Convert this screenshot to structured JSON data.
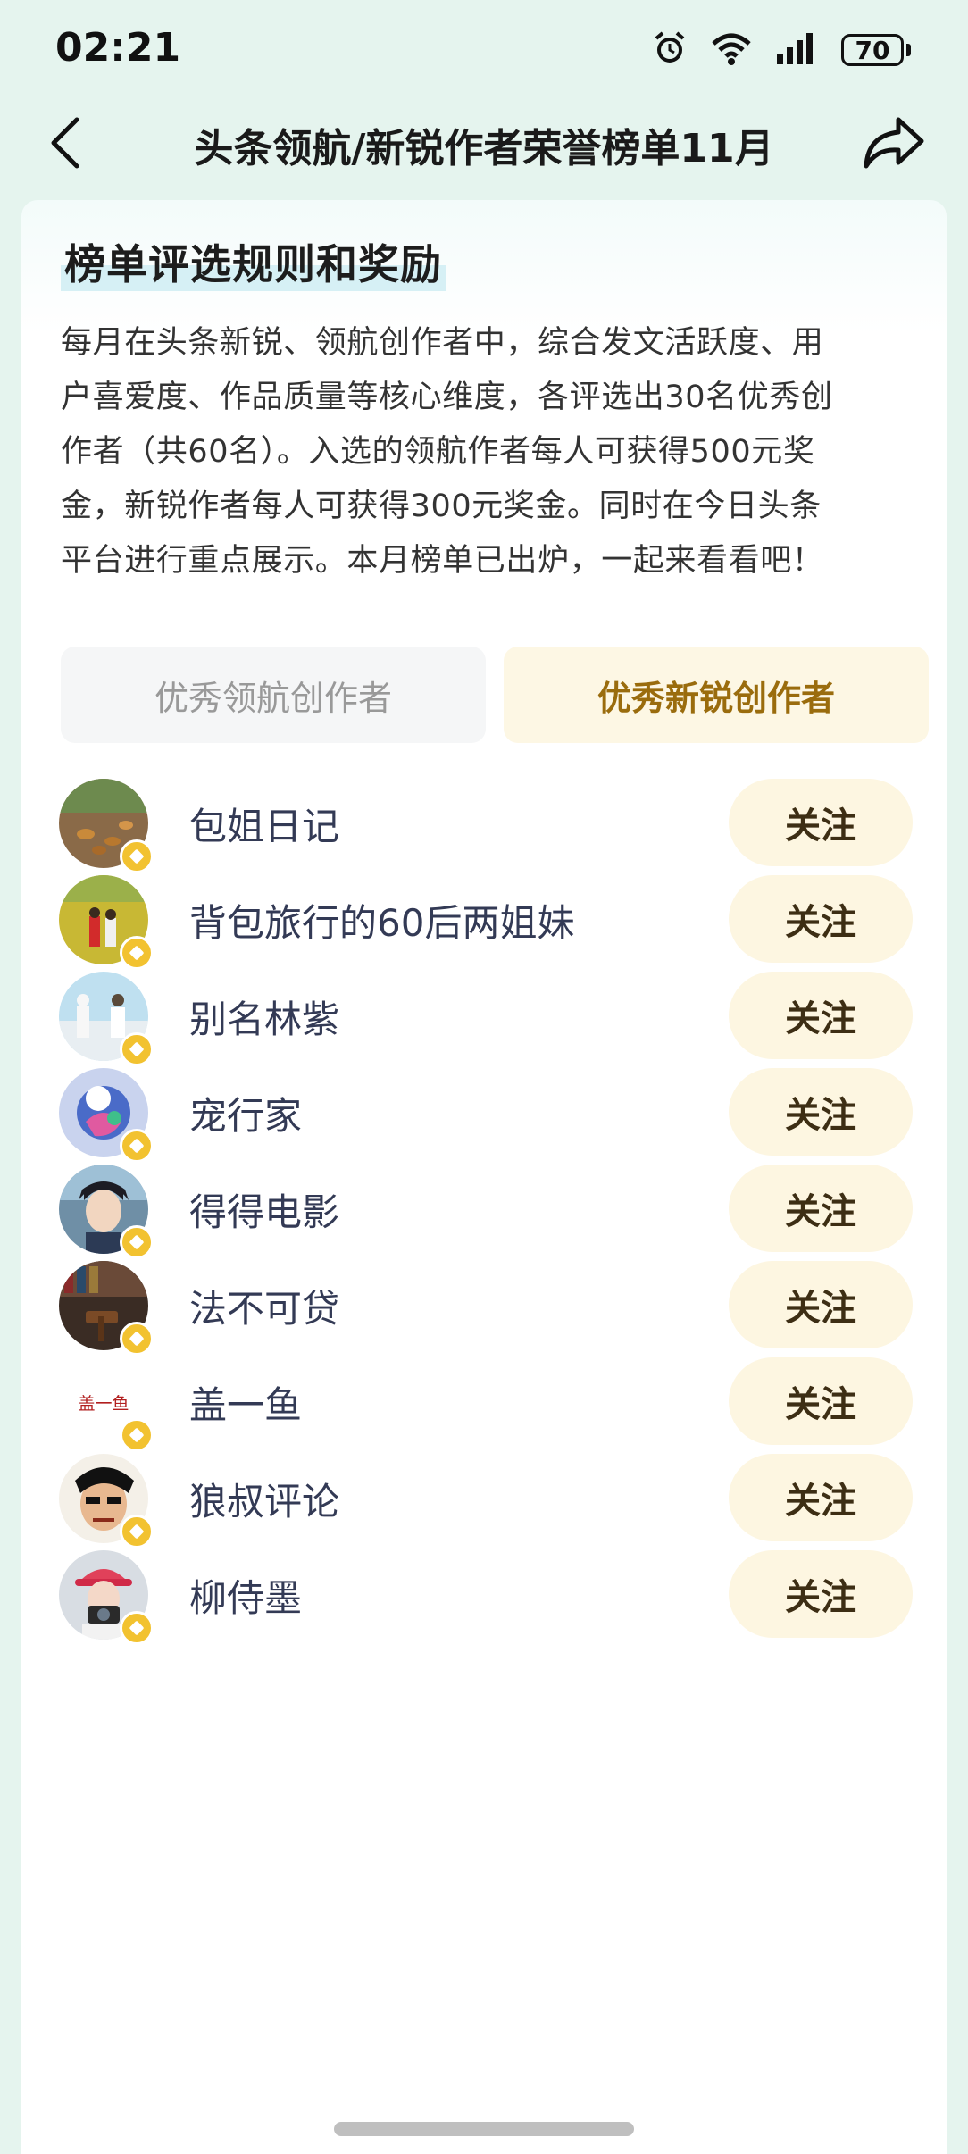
{
  "status": {
    "time": "02:21",
    "battery": "70",
    "icons": [
      "alarm-icon",
      "wifi-icon",
      "signal-icon",
      "battery-icon"
    ]
  },
  "nav": {
    "title": "头条领航/新锐作者荣誉榜单11月",
    "back_icon": "chevron-left-icon",
    "share_icon": "share-icon"
  },
  "rules": {
    "title": "榜单评选规则和奖励",
    "lines": [
      "每月在头条新锐、领航创作者中，综合发文活跃度、用",
      "户喜爱度、作品质量等核心维度，各评选出30名优秀创",
      "作者（共60名）。入选的领航作者每人可获得500元奖",
      "金，新锐作者每人可获得300元奖金。同时在今日头条",
      "平台进行重点展示。本月榜单已出炉，一起来看看吧！"
    ]
  },
  "tabs": [
    {
      "label": "优秀领航创作者",
      "active": false
    },
    {
      "label": "优秀新锐创作者",
      "active": true
    }
  ],
  "authors": [
    {
      "name": "包姐日记",
      "follow": "关注"
    },
    {
      "name": "背包旅行的60后两姐妹",
      "follow": "关注"
    },
    {
      "name": "别名林紫",
      "follow": "关注"
    },
    {
      "name": "宠行家",
      "follow": "关注"
    },
    {
      "name": "得得电影",
      "follow": "关注"
    },
    {
      "name": "法不可贷",
      "follow": "关注"
    },
    {
      "name": "盖一鱼",
      "follow": "关注",
      "avatar_text": "盖一鱼"
    },
    {
      "name": "狼叔评论",
      "follow": "关注"
    },
    {
      "name": "柳侍墨",
      "follow": "关注"
    }
  ]
}
